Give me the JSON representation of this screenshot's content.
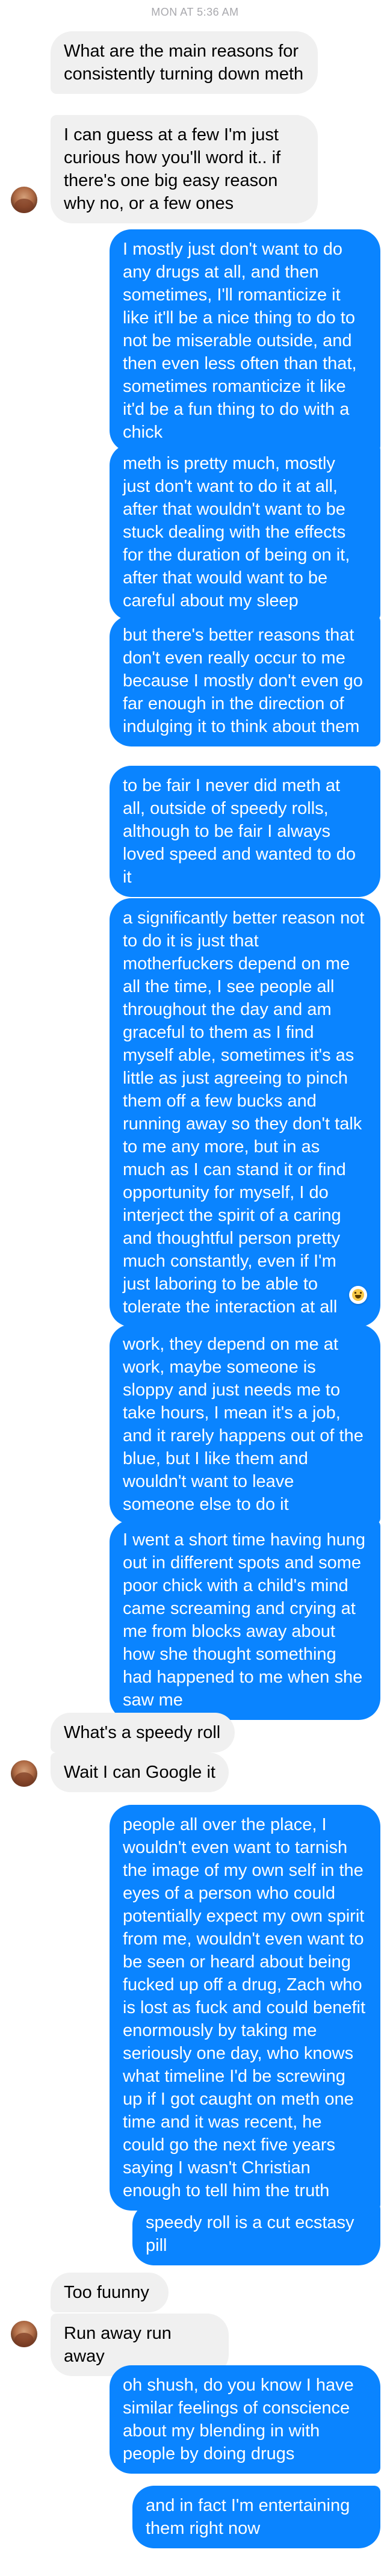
{
  "header": {
    "timestamp": "MON AT 5:36 AM"
  },
  "messages": [
    {
      "sender": "them",
      "text": "What are the main reasons for consistently turning down meth"
    },
    {
      "sender": "them",
      "text": "I can guess at a few I'm just curious how you'll word it.. if there's one big easy reason why no, or a few ones"
    },
    {
      "sender": "me",
      "text": "I mostly just don't want to do any drugs at all, and then sometimes, I'll romanticize it like it'll be a nice thing to do to not be miserable outside, and then even less often than that, sometimes romanticize it like it'd be a fun thing to do with a chick"
    },
    {
      "sender": "me",
      "text": "meth is pretty much, mostly just don't want to do it at all, after that wouldn't want to be stuck dealing with the effects for the duration of being on it, after that would want to be careful about my sleep"
    },
    {
      "sender": "me",
      "text": "but there's better reasons that don't even really occur to me because I mostly don't even go far enough in the direction of indulging it to think about them"
    },
    {
      "sender": "me",
      "text": "to be fair I never did meth at all, outside of speedy rolls, although to be fair I always loved speed and wanted to do it"
    },
    {
      "sender": "me",
      "text": "a significantly better reason not to do it is just that motherfuckers depend on me all the time, I see people all throughout the day and am graceful to them as I find myself able, sometimes it's as little as just agreeing to pinch them off a few bucks and running away so they don't talk to me any more, but in as much as I can stand it or find opportunity for myself, I do interject the spirit of a caring and thoughtful person pretty much constantly, even if I'm just laboring to be able to tolerate the interaction at all",
      "reaction": "laughing-face"
    },
    {
      "sender": "me",
      "text": "work, they depend on me at work, maybe someone is sloppy and just needs me to take hours, I mean it's a job, and it rarely happens out of the blue, but I like them and wouldn't want to leave someone else to do it"
    },
    {
      "sender": "me",
      "text": "I went a short time having hung out in different spots and some poor chick with a child's mind came screaming and crying at me from blocks away about how she thought something had happened to me when she saw me"
    },
    {
      "sender": "them",
      "text": "What's a speedy roll"
    },
    {
      "sender": "them",
      "text": "Wait I can Google it"
    },
    {
      "sender": "me",
      "text": "people all over the place, I wouldn't even want to tarnish the image of my own self in the eyes of a person who could potentially expect my own spirit from me, wouldn't even want to be seen or heard about being fucked up off a drug, Zach who is lost as fuck and could benefit enormously by taking me seriously one day, who knows what timeline I'd be screwing up if I got caught on meth one time and it was recent, he could go the next five years saying I wasn't Christian enough to tell him the truth"
    },
    {
      "sender": "me",
      "text": "speedy roll is a cut ecstasy pill"
    },
    {
      "sender": "them",
      "text": "Too fuunny"
    },
    {
      "sender": "them",
      "text": "Run away run away"
    },
    {
      "sender": "me",
      "text": "oh shush, do you know I have similar feelings of conscience about my blending in with people by doing drugs"
    },
    {
      "sender": "me",
      "text": "and in fact I'm entertaining them right now"
    }
  ],
  "colors": {
    "sent_bubble": "#0a84ff",
    "received_bubble": "#f0f0f0",
    "timestamp_text": "#a8a8ad"
  }
}
